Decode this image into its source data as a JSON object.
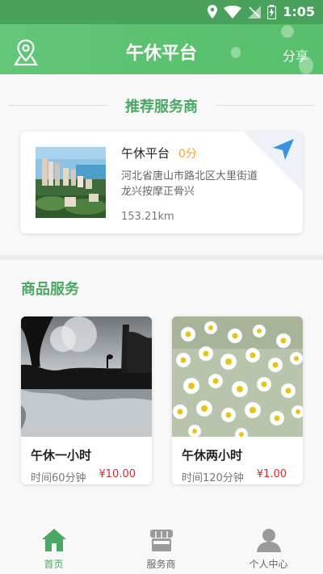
{
  "statusbar": {
    "time": "1:05"
  },
  "header": {
    "title": "午休平台",
    "share_label": "分享"
  },
  "recommend": {
    "title": "推荐服务商",
    "provider": {
      "name": "午休平台",
      "score": "0分",
      "address": "河北省唐山市路北区大里街道龙兴按摩正骨兴",
      "distance": "153.21km"
    }
  },
  "products": {
    "title": "商品服务",
    "items": [
      {
        "name": "午休一小时",
        "time": "时间60分钟",
        "price": "¥10.00"
      },
      {
        "name": "午休两小时",
        "time": "时间120分钟",
        "price": "¥1.00"
      }
    ]
  },
  "tabbar": {
    "items": [
      {
        "label": "首页",
        "active": true
      },
      {
        "label": "服务商",
        "active": false
      },
      {
        "label": "个人中心",
        "active": false
      }
    ]
  },
  "colors": {
    "accent": "#4aa862",
    "price": "#d42a2a",
    "score": "#f0a230"
  }
}
